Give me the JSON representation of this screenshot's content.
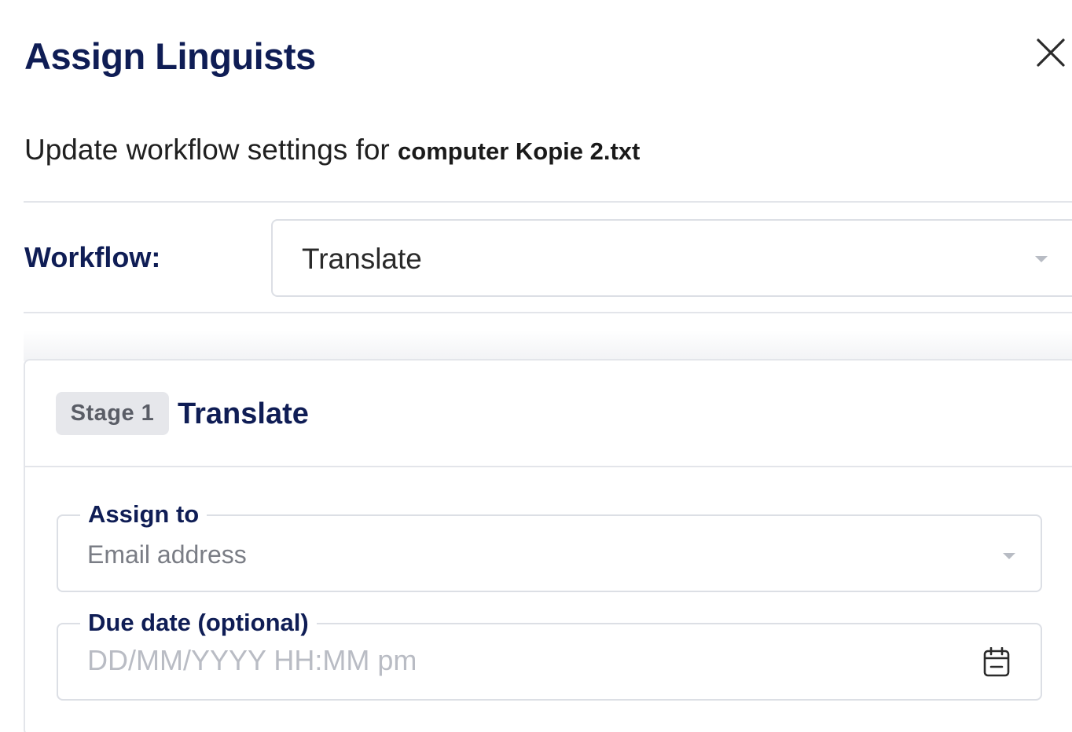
{
  "dialog": {
    "title": "Assign Linguists",
    "close_icon": "close-icon",
    "subtitle_prefix": "Update workflow settings for",
    "filename": "computer Kopie 2.txt"
  },
  "workflow": {
    "label": "Workflow:",
    "selected": "Translate",
    "dropdown_icon": "caret-down-icon"
  },
  "stage": {
    "badge": "Stage 1",
    "name": "Translate",
    "assign_to": {
      "label": "Assign to",
      "placeholder": "Email address",
      "dropdown_icon": "caret-down-icon"
    },
    "due_date": {
      "label": "Due date (optional)",
      "placeholder": "DD/MM/YYYY HH:MM pm",
      "icon": "calendar-icon"
    }
  },
  "colors": {
    "heading": "#0f1d55",
    "border": "#dcdfe5",
    "badge_bg": "#e6e7eb",
    "placeholder": "#b9bcc4"
  }
}
